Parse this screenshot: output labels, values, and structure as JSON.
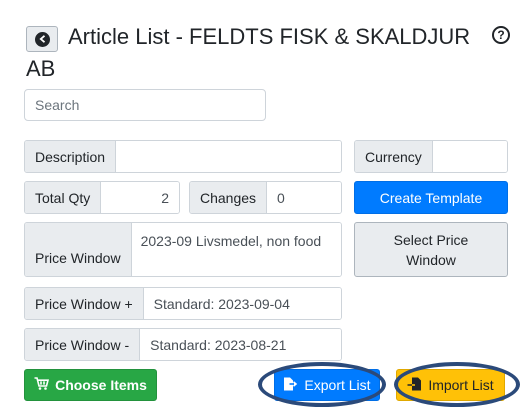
{
  "header": {
    "title_line1": "Article List - FELDTS FISK & SKALDJUR",
    "title_line2": "AB",
    "help_glyph": "?"
  },
  "search": {
    "placeholder": "Search"
  },
  "fields": {
    "description_label": "Description",
    "description_value": "",
    "currency_label": "Currency",
    "currency_value": "",
    "total_qty_label": "Total Qty",
    "total_qty_value": "2",
    "changes_label": "Changes",
    "changes_value": "0",
    "price_window_label": "Price Window",
    "price_window_value": "2023-09 Livsmedel, non food",
    "price_window_plus_label": "Price Window +",
    "price_window_plus_value": "Standard: 2023-09-04",
    "price_window_minus_label": "Price Window -",
    "price_window_minus_value": "Standard: 2023-08-21"
  },
  "buttons": {
    "create_template": "Create Template",
    "select_price_window": "Select Price Window",
    "choose_items": "Choose Items",
    "export_list": "Export List",
    "import_list": "Import List"
  },
  "colors": {
    "primary": "#007bff",
    "success": "#28a745",
    "warning": "#ffc107",
    "highlight_ring": "#2b4a7a"
  }
}
